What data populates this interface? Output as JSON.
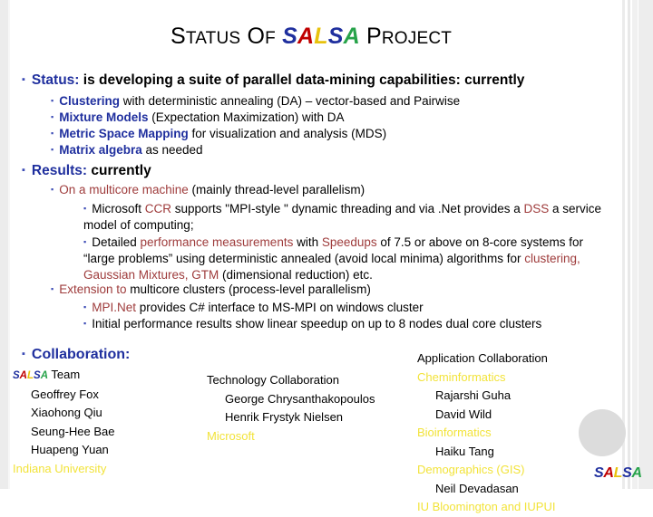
{
  "slide": {
    "title": {
      "prefix": "Status of ",
      "prefix_caps": "S",
      "prefix_rest": "TATUS",
      "of_caps": "O",
      "of_rest": "F",
      "salsa_letters": [
        "S",
        "A",
        "L",
        "S",
        "A"
      ],
      "suffix_caps": "P",
      "suffix_rest": "ROJECT"
    },
    "status": {
      "label": "Status:",
      "text": " is developing a suite of parallel data-mining capabilities: currently",
      "items": [
        {
          "keyword": "Clustering",
          "rest": " with deterministic annealing (DA) – vector-based and Pairwise"
        },
        {
          "keyword": "Mixture Models",
          "rest": " (Expectation Maximization) with DA"
        },
        {
          "keyword": "Metric Space Mapping",
          "rest": " for visualization and analysis (MDS)"
        },
        {
          "keyword": "Matrix algebra",
          "rest": " as needed"
        }
      ]
    },
    "results": {
      "label": "Results:",
      "text": " currently",
      "multicore": {
        "highlight": "On a  multicore machine",
        "rest": "  (mainly  thread-level parallelism)"
      },
      "ccr_line": {
        "p1": "Microsoft ",
        "h1": "CCR",
        "p2": " supports \"MPI-style \" dynamic threading and via  .Net provides a ",
        "h2": "DSS",
        "p3": " a service model of computing;"
      },
      "perf_line": {
        "p1": "Detailed ",
        "h1": "performance measurements",
        "p2": " with  ",
        "h2": "Speedups",
        "p3": "  of 7.5 or above on 8-core systems for “large problems” using deterministic annealed (avoid local minima) algorithms for ",
        "h3": "clustering, Gaussian Mixtures, GTM",
        "p4": " (dimensional reduction) etc."
      },
      "extension": {
        "highlight": "Extension to",
        "rest": "  multicore clusters  (process-level parallelism)"
      },
      "mpinet": {
        "highlight": "MPI.Net",
        "rest": "  provides C# interface to MS-MPI on windows cluster"
      },
      "initial": "Initial performance results show linear speedup  on  up to  8 nodes  dual core clusters"
    },
    "collaboration": {
      "label": "Collaboration:",
      "columns": [
        {
          "name": "salsa-team",
          "header_salsa": "SALSA",
          "header_rest": " Team",
          "members": [
            "Geoffrey Fox",
            "Xiaohong Qiu",
            "Seung-Hee Bae",
            "Huapeng Yuan"
          ],
          "footer": "Indiana University"
        },
        {
          "name": "technology-collaboration",
          "header": "Technology Collaboration",
          "members": [
            "George Chrysanthakopoulos",
            "Henrik Frystyk Nielsen"
          ],
          "footer": "Microsoft"
        },
        {
          "name": "application-collaboration",
          "header": "Application Collaboration",
          "groups": [
            {
              "title": "Cheminformatics",
              "members": [
                "Rajarshi Guha",
                "David Wild"
              ]
            },
            {
              "title": "Bioinformatics",
              "members": [
                "Haiku Tang"
              ]
            },
            {
              "title": "Demographics (GIS)",
              "members": [
                "Neil Devadasan"
              ]
            }
          ],
          "footer": "IU Bloomington and IUPUI"
        }
      ]
    },
    "logo_letters": [
      "S",
      "A",
      "L",
      "S",
      "A"
    ],
    "colors": {
      "heading_blue": "#1f2f9e",
      "bullet_blue": "#3b4bb5",
      "maroon": "#9e3b3b",
      "gold": "#f2e33a",
      "salsa_s": "#1f2f9e",
      "salsa_a": "#c00000",
      "salsa_l": "#e8c20d",
      "salsa_a2": "#27a34a"
    }
  }
}
